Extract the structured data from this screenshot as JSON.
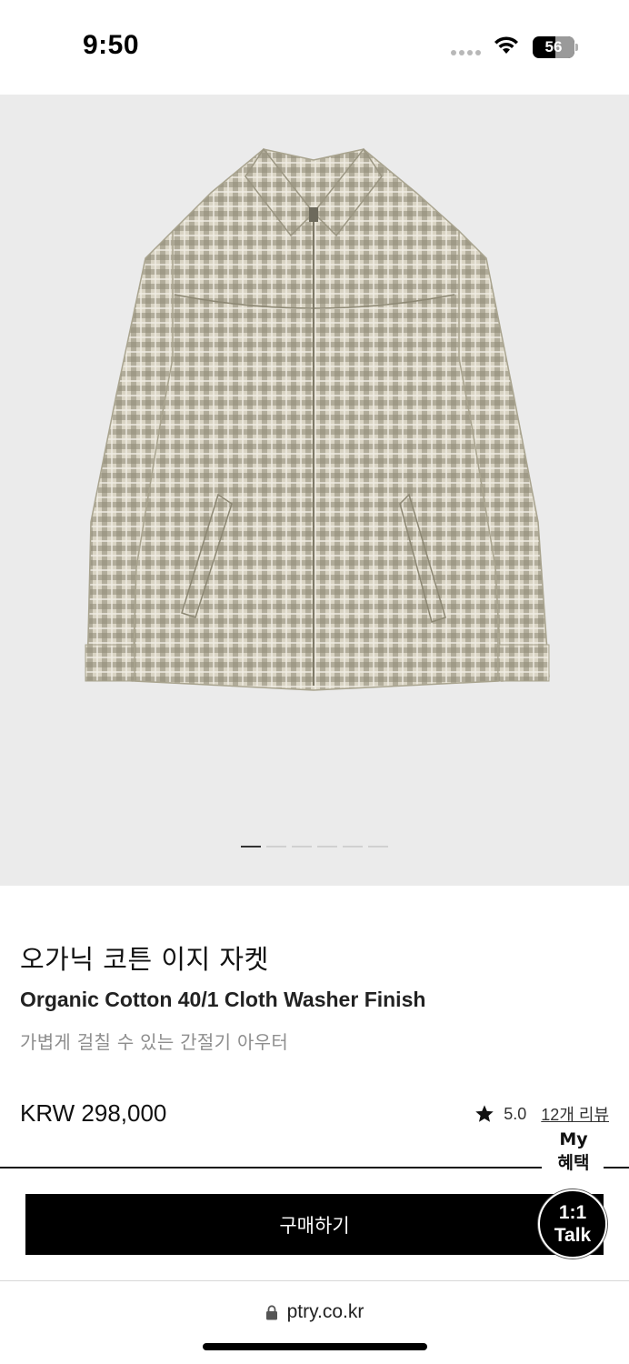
{
  "status_bar": {
    "time": "9:50",
    "battery": "56",
    "icons": [
      "signal-icon",
      "wifi-icon",
      "battery-icon"
    ]
  },
  "product": {
    "image_alt": "plaid zip-up jacket",
    "carousel": {
      "total": 6,
      "active": 1
    },
    "title_ko": "오가닉 코튼 이지 자켓",
    "title_en": "Organic Cotton 40/1 Cloth Washer Finish",
    "subtitle": "가볍게 걸칠 수 있는 간절기 아우터",
    "price": "KRW 298,000",
    "rating": "5.0",
    "reviews": "12개 리뷰"
  },
  "floating": {
    "my_benefit": [
      "My",
      "혜택"
    ],
    "talk": [
      "1:1",
      "Talk"
    ]
  },
  "actions": {
    "buy_label": "구매하기"
  },
  "browser": {
    "url": "ptry.co.kr"
  },
  "colors": {
    "image_bg": "#ebebeb",
    "button_bg": "#000000",
    "subtitle": "#8e8e8e"
  }
}
